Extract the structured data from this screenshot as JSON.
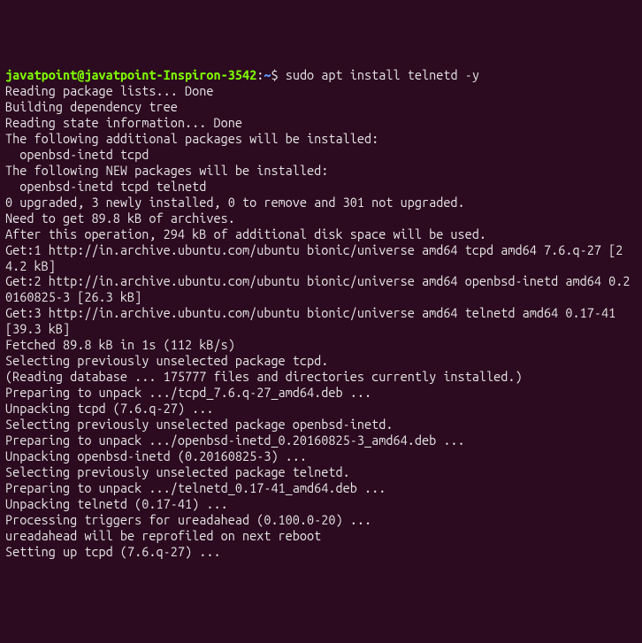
{
  "prompt": {
    "user_host": "javatpoint@javatpoint-Inspiron-3542",
    "colon": ":",
    "path": "~",
    "sigil": "$",
    "command": " sudo apt install telnetd -y"
  },
  "lines": [
    "Reading package lists... Done",
    "Building dependency tree",
    "Reading state information... Done",
    "The following additional packages will be installed:",
    "  openbsd-inetd tcpd",
    "The following NEW packages will be installed:",
    "  openbsd-inetd tcpd telnetd",
    "0 upgraded, 3 newly installed, 0 to remove and 301 not upgraded.",
    "Need to get 89.8 kB of archives.",
    "After this operation, 294 kB of additional disk space will be used.",
    "Get:1 http://in.archive.ubuntu.com/ubuntu bionic/universe amd64 tcpd amd64 7.6.q-27 [24.2 kB]",
    "Get:2 http://in.archive.ubuntu.com/ubuntu bionic/universe amd64 openbsd-inetd amd64 0.20160825-3 [26.3 kB]",
    "Get:3 http://in.archive.ubuntu.com/ubuntu bionic/universe amd64 telnetd amd64 0.17-41 [39.3 kB]",
    "Fetched 89.8 kB in 1s (112 kB/s)",
    "Selecting previously unselected package tcpd.",
    "(Reading database ... 175777 files and directories currently installed.)",
    "Preparing to unpack .../tcpd_7.6.q-27_amd64.deb ...",
    "Unpacking tcpd (7.6.q-27) ...",
    "Selecting previously unselected package openbsd-inetd.",
    "Preparing to unpack .../openbsd-inetd_0.20160825-3_amd64.deb ...",
    "Unpacking openbsd-inetd (0.20160825-3) ...",
    "Selecting previously unselected package telnetd.",
    "Preparing to unpack .../telnetd_0.17-41_amd64.deb ...",
    "Unpacking telnetd (0.17-41) ...",
    "Processing triggers for ureadahead (0.100.0-20) ...",
    "ureadahead will be reprofiled on next reboot",
    "Setting up tcpd (7.6.q-27) ..."
  ]
}
